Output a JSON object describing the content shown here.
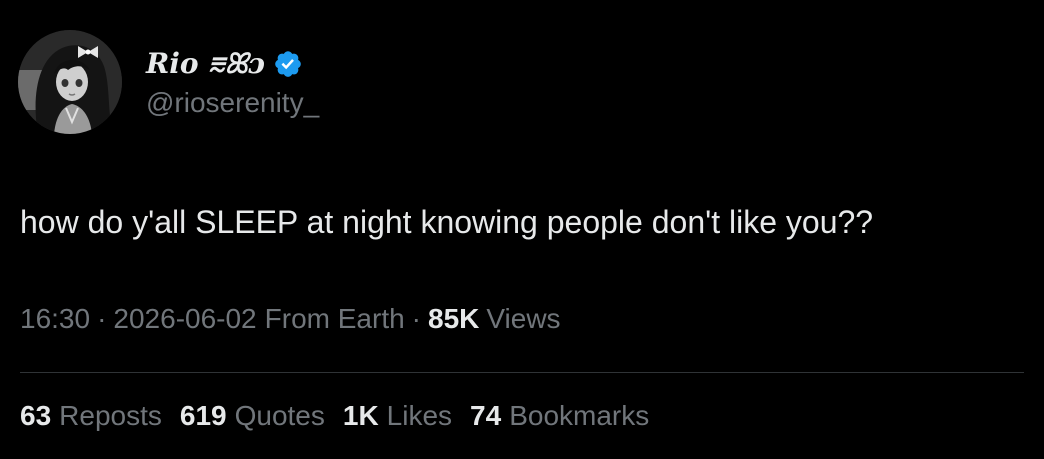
{
  "tweet": {
    "author": {
      "display_name": "Rio ⩳ꕤɔ",
      "handle": "@rioserenity_",
      "avatar_icon": "anime-girl-avatar",
      "verified": true,
      "verified_color": "#1d9bf0"
    },
    "text": "how do y'all SLEEP at night knowing people don't like you??",
    "meta": {
      "time": "16:30",
      "date": "2026-06-02",
      "location": "From Earth",
      "views_count": "85K",
      "views_label": "Views",
      "separator": "·"
    },
    "stats": [
      {
        "count": "63",
        "label": "Reposts"
      },
      {
        "count": "619",
        "label": "Quotes"
      },
      {
        "count": "1K",
        "label": "Likes"
      },
      {
        "count": "74",
        "label": "Bookmarks"
      }
    ]
  },
  "colors": {
    "background": "#000000",
    "primary_text": "#e7e9ea",
    "secondary_text": "#71767b",
    "divider": "#2f3336"
  }
}
